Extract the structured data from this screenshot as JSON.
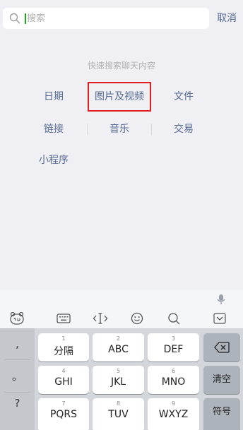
{
  "search": {
    "placeholder": "搜索",
    "cancel_label": "取消"
  },
  "hint": "快速搜索聊天内容",
  "categories": {
    "date": "日期",
    "images_videos": "图片及视频",
    "files": "文件",
    "links": "链接",
    "music": "音乐",
    "transactions": "交易",
    "mini_programs": "小程序"
  },
  "keyboard": {
    "toolbar": [
      "du-logo-icon",
      "keyboard-icon",
      "cursor-move-icon",
      "emoji-icon",
      "search-icon",
      "collapse-keyboard-icon"
    ],
    "punctuation": [
      ",",
      "。",
      "?"
    ],
    "keys": [
      {
        "num": "1",
        "label": "分隔"
      },
      {
        "num": "2",
        "label": "ABC"
      },
      {
        "num": "3",
        "label": "DEF"
      },
      {
        "num": "4",
        "label": "GHI"
      },
      {
        "num": "5",
        "label": "JKL"
      },
      {
        "num": "6",
        "label": "MNO"
      },
      {
        "num": "7",
        "label": "PQRS"
      },
      {
        "num": "8",
        "label": "TUV"
      },
      {
        "num": "9",
        "label": "WXYZ"
      }
    ],
    "clear_label": "清空",
    "symbols_label": "符号"
  },
  "colors": {
    "background": "#efeff4",
    "link": "#576b95",
    "highlight": "#e02020",
    "caret": "#1aad19"
  }
}
